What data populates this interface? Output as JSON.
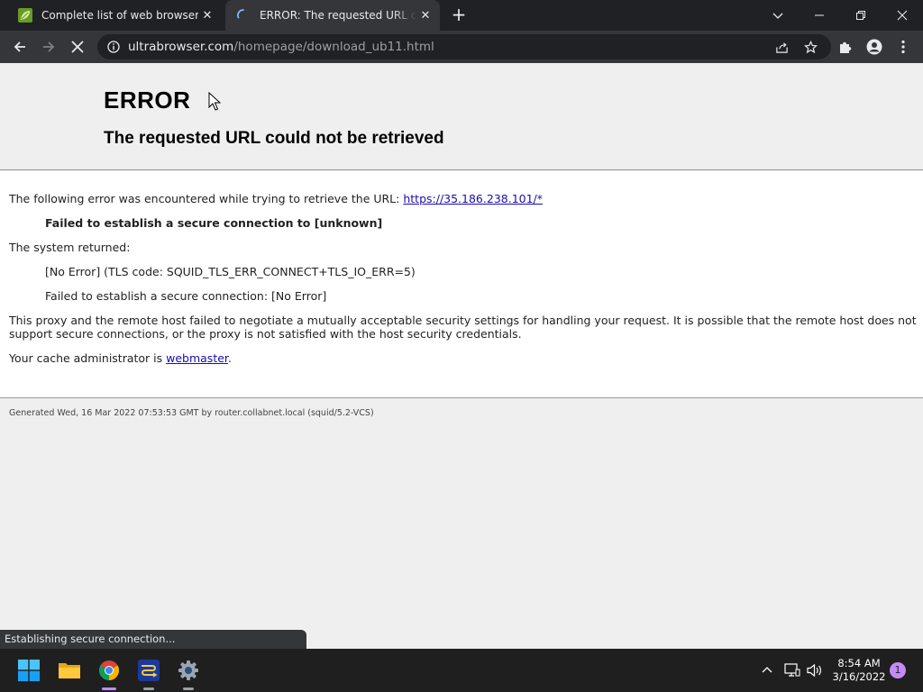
{
  "browser": {
    "tabs": [
      {
        "title": "Complete list of web browsers",
        "favicon": "green-leaf-favicon-icon",
        "close": "✕"
      },
      {
        "title": "ERROR: The requested URL could not be retrieved",
        "favicon": "loading-spinner-icon",
        "close": "✕"
      }
    ],
    "new_tab": "+",
    "address": {
      "host": "ultrabrowser.com",
      "path": "/homepage/download_ub11.html"
    },
    "status_text": "Establishing secure connection..."
  },
  "page": {
    "title": "ERROR",
    "subtitle": "The requested URL could not be retrieved",
    "intro": "The following error was encountered while trying to retrieve the URL: ",
    "error_url": "https://35.186.238.101/*",
    "failure": "Failed to establish a secure connection to [unknown]",
    "system_returned": "The system returned:",
    "tls_code": "[No Error] (TLS code: SQUID_TLS_ERR_CONNECT+TLS_IO_ERR=5)",
    "tls_detail": "Failed to establish a secure connection: [No Error]",
    "explanation_line1": "This proxy and the remote host failed to negotiate a mutually acceptable security settings for handling your request. It is possible that the remote host does not",
    "explanation_line2": "support secure connections, or the proxy is not satisfied with the host security credentials.",
    "admin_prefix": "Your cache administrator is ",
    "admin_link": "webmaster",
    "admin_suffix": ".",
    "footer": "Generated Wed, 16 Mar 2022 07:53:53 GMT by router.collabnet.local (squid/5.2-VCS)"
  },
  "taskbar": {
    "apps": [
      "windows-start-icon",
      "file-explorer-icon",
      "chrome-icon",
      "network-tool-icon",
      "settings-gear-icon"
    ],
    "time": "8:54 AM",
    "date": "3/16/2022",
    "notification_count": "1"
  },
  "colors": {
    "tabbar": "#202124",
    "toolbar": "#35363a",
    "link": "#1a0dab",
    "accent": "#c58af9"
  }
}
